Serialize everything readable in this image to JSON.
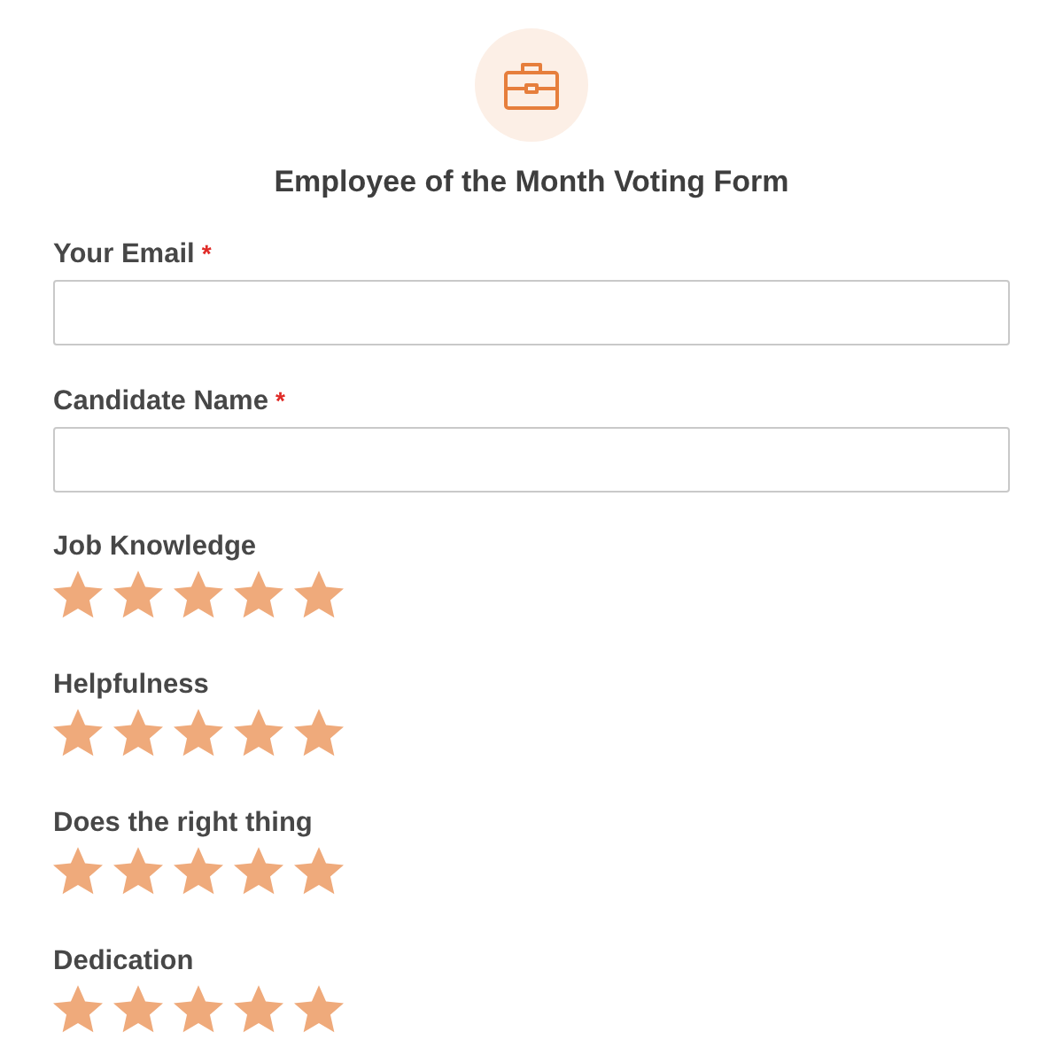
{
  "form": {
    "title": "Employee of the Month Voting Form"
  },
  "fields": [
    {
      "label": "Your Email",
      "required_mark": "*"
    },
    {
      "label": "Candidate Name",
      "required_mark": "*"
    }
  ],
  "ratings": [
    {
      "label": "Job Knowledge",
      "stars": 5
    },
    {
      "label": "Helpfulness",
      "stars": 5
    },
    {
      "label": "Does the right thing",
      "stars": 5
    },
    {
      "label": "Dedication",
      "stars": 5
    }
  ]
}
